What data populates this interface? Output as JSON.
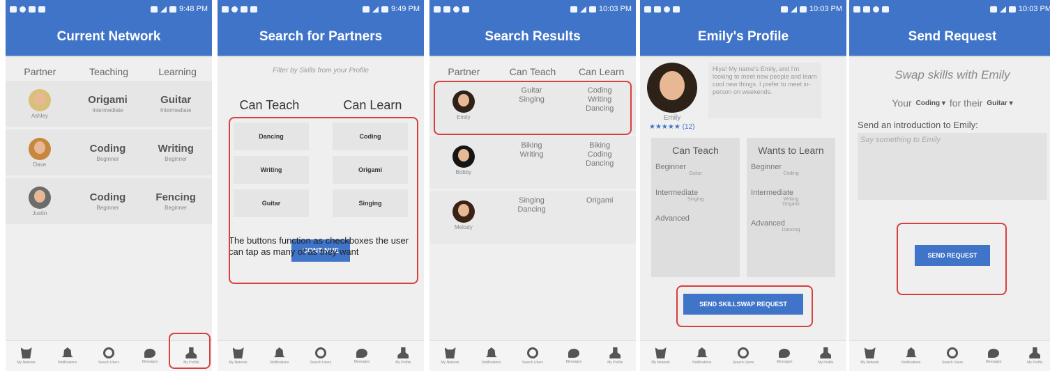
{
  "status": {
    "screen1_time": "9:48 PM",
    "screen2_time": "9:49 PM",
    "screen3_time": "10:03 PM",
    "screen4_time": "10:03 PM",
    "screen5_time": "10:03 PM"
  },
  "nav": {
    "network": "My Network",
    "notifications": "Notifications",
    "search": "Search Users",
    "messages": "Messages",
    "profile": "My Profile"
  },
  "current_network": {
    "title": "Current Network",
    "headers": {
      "partner": "Partner",
      "teaching": "Teaching",
      "learning": "Learning"
    },
    "rows": [
      {
        "name": "Ashley",
        "teach": "Origami",
        "teach_level": "Intermediate",
        "learn": "Guitar",
        "learn_level": "Intermediate"
      },
      {
        "name": "Dave",
        "teach": "Coding",
        "teach_level": "Beginner",
        "learn": "Writing",
        "learn_level": "Beginner"
      },
      {
        "name": "Justin",
        "teach": "Coding",
        "teach_level": "Beginner",
        "learn": "Fencing",
        "learn_level": "Beginner"
      }
    ]
  },
  "search": {
    "title": "Search for Partners",
    "subtitle": "Filter by Skills from your Profile",
    "can_teach": "Can Teach",
    "can_learn": "Can Learn",
    "teach_options": [
      "Dancing",
      "Writing",
      "Guitar"
    ],
    "learn_options": [
      "Coding",
      "Origami",
      "Singing"
    ],
    "continue": "CONTINUE",
    "note": "The buttons function as checkboxes the user can tap as many of as they want"
  },
  "results": {
    "title": "Search Results",
    "headers": {
      "partner": "Partner",
      "teach": "Can Teach",
      "learn": "Can Learn"
    },
    "rows": [
      {
        "name": "Emily",
        "teach": [
          "Guitar",
          "Singing"
        ],
        "learn": [
          "Coding",
          "Writing",
          "Dancing"
        ]
      },
      {
        "name": "Bobby",
        "teach": [
          "Biking",
          "Writing"
        ],
        "learn": [
          "Biking",
          "Coding",
          "Dancing"
        ]
      },
      {
        "name": "Melody",
        "teach": [
          "Singing",
          "Dancing"
        ],
        "learn": [
          "Origami"
        ]
      }
    ]
  },
  "profile": {
    "title": "Emily's Profile",
    "name": "Emily",
    "bio": "Hiya! My name's Emily, and I'm looking to meet new people and learn cool new things. I prefer to meet in-person on weekends.",
    "stars": "★★★★★",
    "rating_count": "(12)",
    "can_teach": "Can Teach",
    "wants_to_learn": "Wants to Learn",
    "teach": {
      "beginner": "Beginner",
      "beginner_skills": "Guitar",
      "intermediate": "Intermediate",
      "intermediate_skills": "Singing",
      "advanced": "Advanced",
      "advanced_skills": ""
    },
    "learn": {
      "beginner": "Beginner",
      "beginner_skills": "Coding",
      "intermediate": "Intermediate",
      "intermediate_skills": "Writing Origami",
      "advanced": "Advanced",
      "advanced_skills": "Dancing"
    },
    "button": "SEND SKILLSWAP REQUEST"
  },
  "request": {
    "title": "Send Request",
    "swap": "Swap skills with Emily",
    "your": "Your",
    "your_skill": "Coding",
    "for_their": "for their",
    "their_skill": "Guitar",
    "intro_label": "Send an introduction to Emily:",
    "intro_placeholder": "Say something to Emily",
    "button": "SEND REQUEST"
  }
}
